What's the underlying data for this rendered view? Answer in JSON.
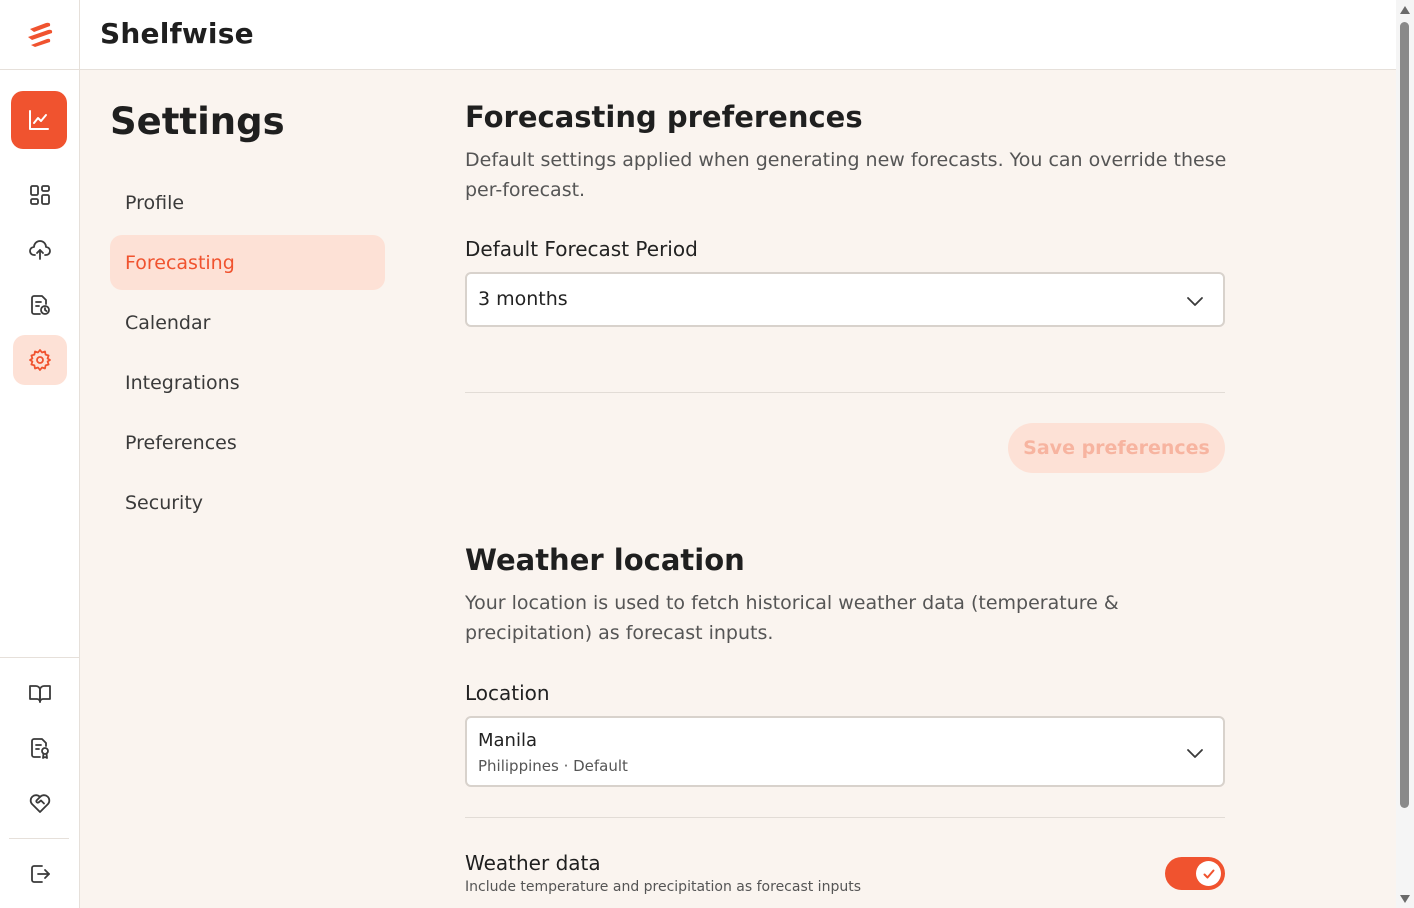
{
  "app": {
    "name": "Shelfwise"
  },
  "rail": {
    "items": [
      "analytics",
      "dashboard",
      "upload",
      "reports",
      "settings"
    ],
    "bottom_items": [
      "docs",
      "certificate",
      "support",
      "logout"
    ]
  },
  "settings_nav": {
    "title": "Settings",
    "items": [
      {
        "label": "Profile"
      },
      {
        "label": "Forecasting"
      },
      {
        "label": "Calendar"
      },
      {
        "label": "Integrations"
      },
      {
        "label": "Preferences"
      },
      {
        "label": "Security"
      }
    ],
    "active": "Forecasting"
  },
  "forecasting": {
    "title": "Forecasting preferences",
    "description": "Default settings applied when generating new forecasts. You can override these per-forecast.",
    "period_label": "Default Forecast Period",
    "period_value": "3 months",
    "save_label": "Save preferences"
  },
  "weather": {
    "title": "Weather location",
    "description": "Your location is used to fetch historical weather data (temperature & precipitation) as forecast inputs.",
    "location_label": "Location",
    "location_value": "Manila",
    "location_sub": "Philippines · Default",
    "toggle_title": "Weather data",
    "toggle_desc": "Include temperature and precipitation as forecast inputs",
    "toggle_on": true
  },
  "colors": {
    "accent": "#f0532f",
    "accent_soft": "#fde1d6",
    "background": "#faf4ef"
  }
}
